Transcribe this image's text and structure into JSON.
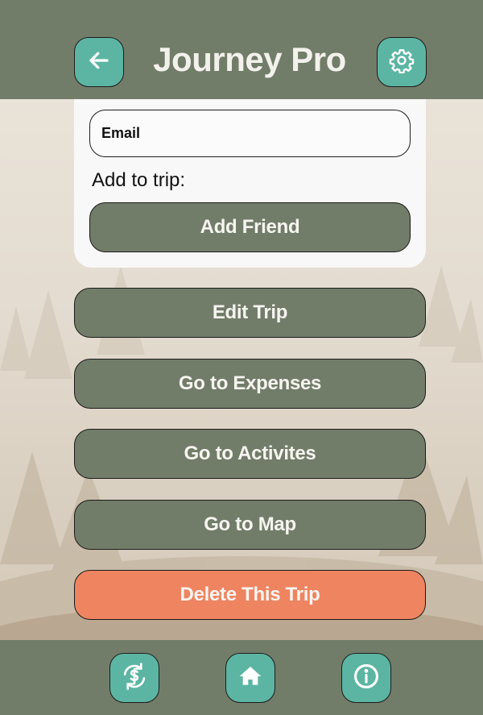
{
  "header": {
    "title": "Journey Pro",
    "back_icon": "arrow-left-icon",
    "settings_icon": "gear-icon"
  },
  "friend_card": {
    "email_placeholder": "Email",
    "add_to_trip_label": "Add to trip:",
    "add_friend_label": "Add Friend"
  },
  "actions": {
    "edit_trip": "Edit Trip",
    "expenses": "Go to Expenses",
    "activities": "Go to Activites",
    "map": "Go to Map",
    "delete": "Delete This Trip"
  },
  "footer": {
    "sync_icon": "currency-sync-icon",
    "home_icon": "home-icon",
    "info_icon": "info-icon"
  },
  "colors": {
    "bar": "#727d69",
    "accent": "#5cb5a3",
    "danger": "#ef8460",
    "card": "#f8f8f8"
  }
}
